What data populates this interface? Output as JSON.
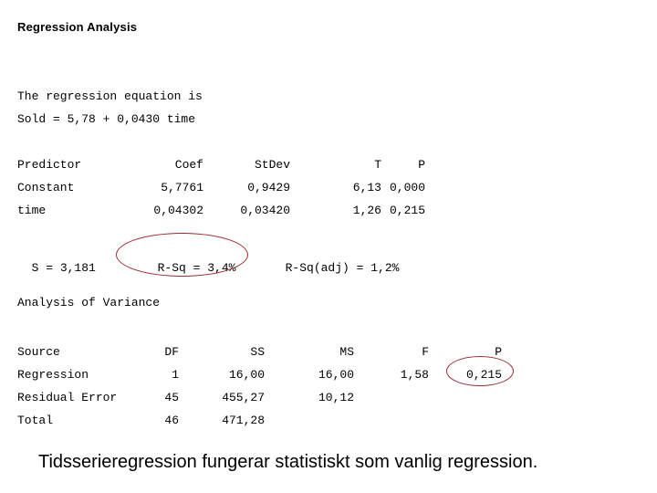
{
  "slide": {
    "title": "Regression Analysis",
    "caption": "Tidsserieregression fungerar statistiskt som vanlig regression."
  },
  "equation": {
    "intro": "The regression equation is",
    "formula": "Sold = 5,78 + 0,0430 time"
  },
  "predictor_table": {
    "headers": [
      "Predictor",
      "Coef",
      "StDev",
      "T",
      "P"
    ],
    "rows": [
      {
        "predictor": "Constant",
        "coef": "5,7761",
        "stdev": "0,9429",
        "t": "6,13",
        "p": "0,000"
      },
      {
        "predictor": "time",
        "coef": "0,04302",
        "stdev": "0,03420",
        "t": "1,26",
        "p": "0,215"
      }
    ]
  },
  "summary": {
    "s": "S = 3,181",
    "r_sq": "R-Sq = 3,4%",
    "r_sq_adj": "R-Sq(adj) = 1,2%"
  },
  "anova": {
    "heading": "Analysis of Variance",
    "headers": [
      "Source",
      "DF",
      "SS",
      "MS",
      "F",
      "P"
    ],
    "rows": [
      {
        "source": "Regression",
        "df": "1",
        "ss": "16,00",
        "ms": "16,00",
        "f": "1,58",
        "p": "0,215"
      },
      {
        "source": "Residual Error",
        "df": "45",
        "ss": "455,27",
        "ms": "10,12",
        "f": "",
        "p": ""
      },
      {
        "source": "Total",
        "df": "46",
        "ss": "471,28",
        "ms": "",
        "f": "",
        "p": ""
      }
    ]
  },
  "annotations": {
    "color": "#9c2a2c",
    "items": [
      {
        "name": "r-sq-highlight",
        "target": "R-Sq = 3,4%"
      },
      {
        "name": "anova-p-value-highlight",
        "target": "0,215"
      }
    ]
  }
}
